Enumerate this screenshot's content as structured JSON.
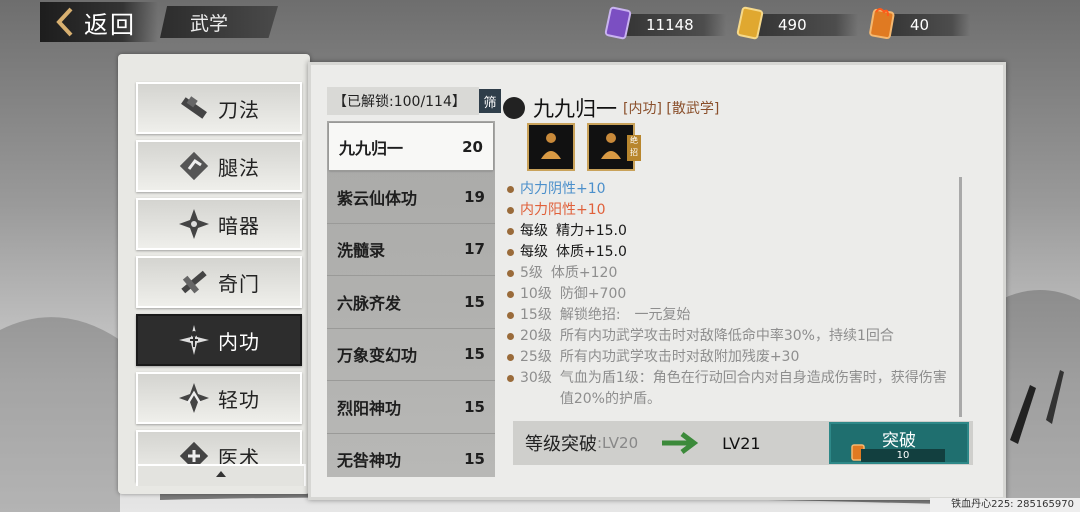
{
  "header": {
    "back_label": "返回",
    "section_title": "武学"
  },
  "currencies": [
    {
      "icon": "purple-scroll-icon",
      "value": "11148",
      "color": "#8a5ec8"
    },
    {
      "icon": "gold-scroll-icon",
      "value": "490",
      "color": "#d9a23a"
    },
    {
      "icon": "fire-scroll-icon",
      "value": "40",
      "color": "#e07a22"
    }
  ],
  "categories": [
    {
      "label": "刀法",
      "icon": "blade-icon"
    },
    {
      "label": "腿法",
      "icon": "kick-icon"
    },
    {
      "label": "暗器",
      "icon": "shuriken-icon"
    },
    {
      "label": "奇门",
      "icon": "exotic-weapon-icon"
    },
    {
      "label": "内功",
      "icon": "inner-power-icon",
      "active": true
    },
    {
      "label": "轻功",
      "icon": "lightness-icon"
    },
    {
      "label": "医术",
      "icon": "medicine-icon"
    }
  ],
  "unlock": {
    "label": "【已解锁:100/114】",
    "filter_label": "筛"
  },
  "skills": [
    {
      "name": "九九归一",
      "level": "20",
      "active": true
    },
    {
      "name": "紫云仙体功",
      "level": "19"
    },
    {
      "name": "洗髓录",
      "level": "17"
    },
    {
      "name": "六脉齐发",
      "level": "15"
    },
    {
      "name": "万象变幻功",
      "level": "15"
    },
    {
      "name": "烈阳神功",
      "level": "15"
    },
    {
      "name": "无咎神功",
      "level": "15"
    }
  ],
  "detail": {
    "name": "九九归一",
    "tags": "[内功] [散武学]",
    "move_badge": "绝招",
    "effects": [
      {
        "lvl": "",
        "text": "内力阴性+10",
        "style": "blue"
      },
      {
        "lvl": "",
        "text": "内力阳性+10",
        "style": "orange"
      },
      {
        "lvl": "每级",
        "text": "精力+15.0",
        "style": "black"
      },
      {
        "lvl": "每级",
        "text": "体质+15.0",
        "style": "black"
      },
      {
        "lvl": "5级",
        "text": "体质+120",
        "style": "grey"
      },
      {
        "lvl": "10级",
        "text": "防御+700",
        "style": "grey"
      },
      {
        "lvl": "15级",
        "text": "解锁绝招:　一元复始",
        "style": "grey"
      },
      {
        "lvl": "20级",
        "text": "所有内功武学攻击时对敌降低命中率30%，持续1回合",
        "style": "grey"
      },
      {
        "lvl": "25级",
        "text": "所有内功武学攻击时对敌附加残废+30",
        "style": "grey"
      },
      {
        "lvl": "30级",
        "text": "气血为盾1级：角色在行动回合内对自身造成伤害时，获得伤害值20%的护盾。",
        "style": "grey"
      }
    ]
  },
  "breakthrough": {
    "label": "等级突破",
    "current": ":LV20",
    "next": "LV21",
    "button": "突破",
    "cost": "10"
  },
  "footer": "铁血丹心225: 285165970"
}
